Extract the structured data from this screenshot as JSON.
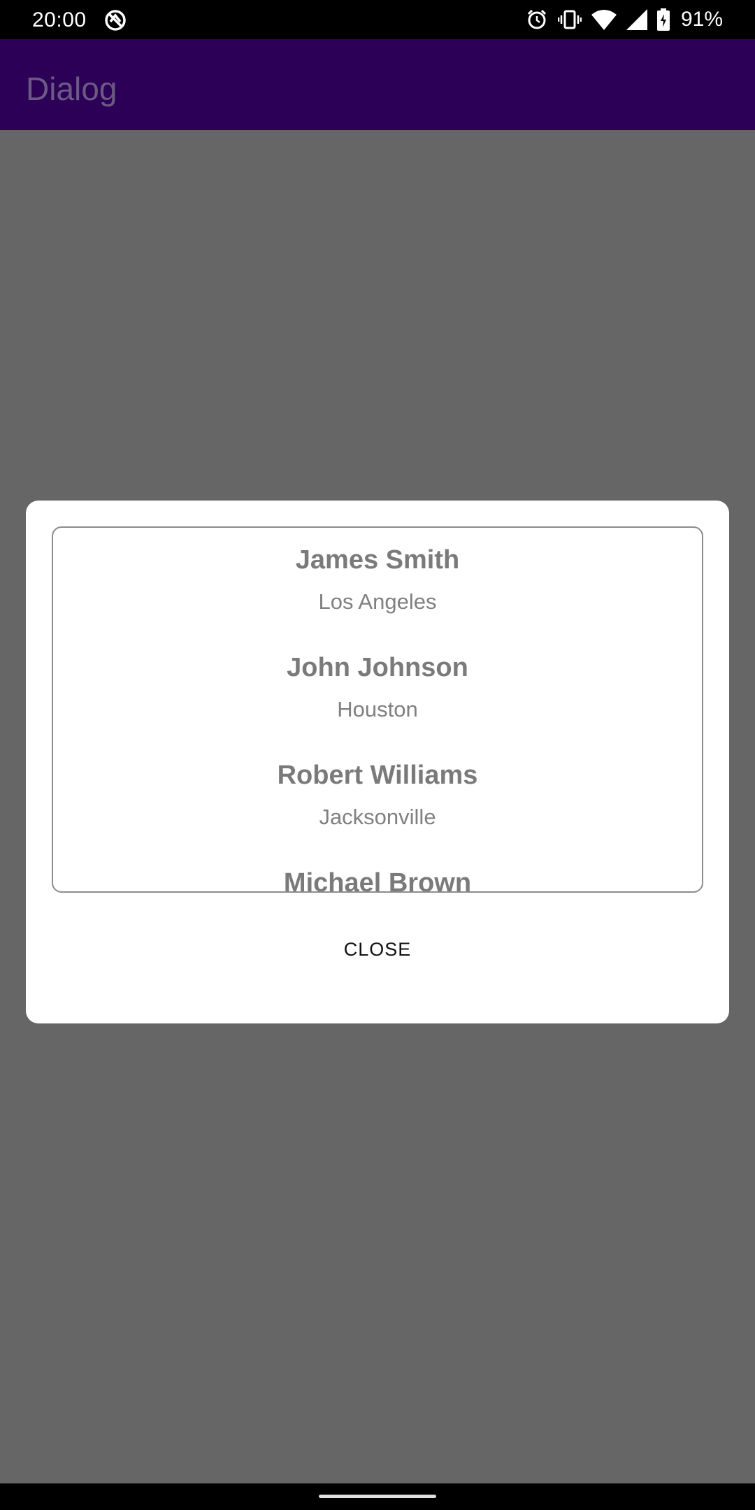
{
  "status_bar": {
    "time": "20:00",
    "battery": "91%",
    "icons": [
      "dnd-icon",
      "alarm-icon",
      "vibrate-icon",
      "wifi-icon",
      "signal-icon",
      "battery-charging-icon"
    ]
  },
  "app_bar": {
    "title": "Dialog"
  },
  "dialog": {
    "items": [
      {
        "name": "James Smith",
        "city": "Los Angeles"
      },
      {
        "name": "John Johnson",
        "city": "Houston"
      },
      {
        "name": "Robert Williams",
        "city": "Jacksonville"
      },
      {
        "name": "Michael Brown",
        "city": ""
      }
    ],
    "close_label": "CLOSE"
  },
  "colors": {
    "app_bar": "#2c0057",
    "scrim": "#666666",
    "dialog": "#ffffff"
  }
}
